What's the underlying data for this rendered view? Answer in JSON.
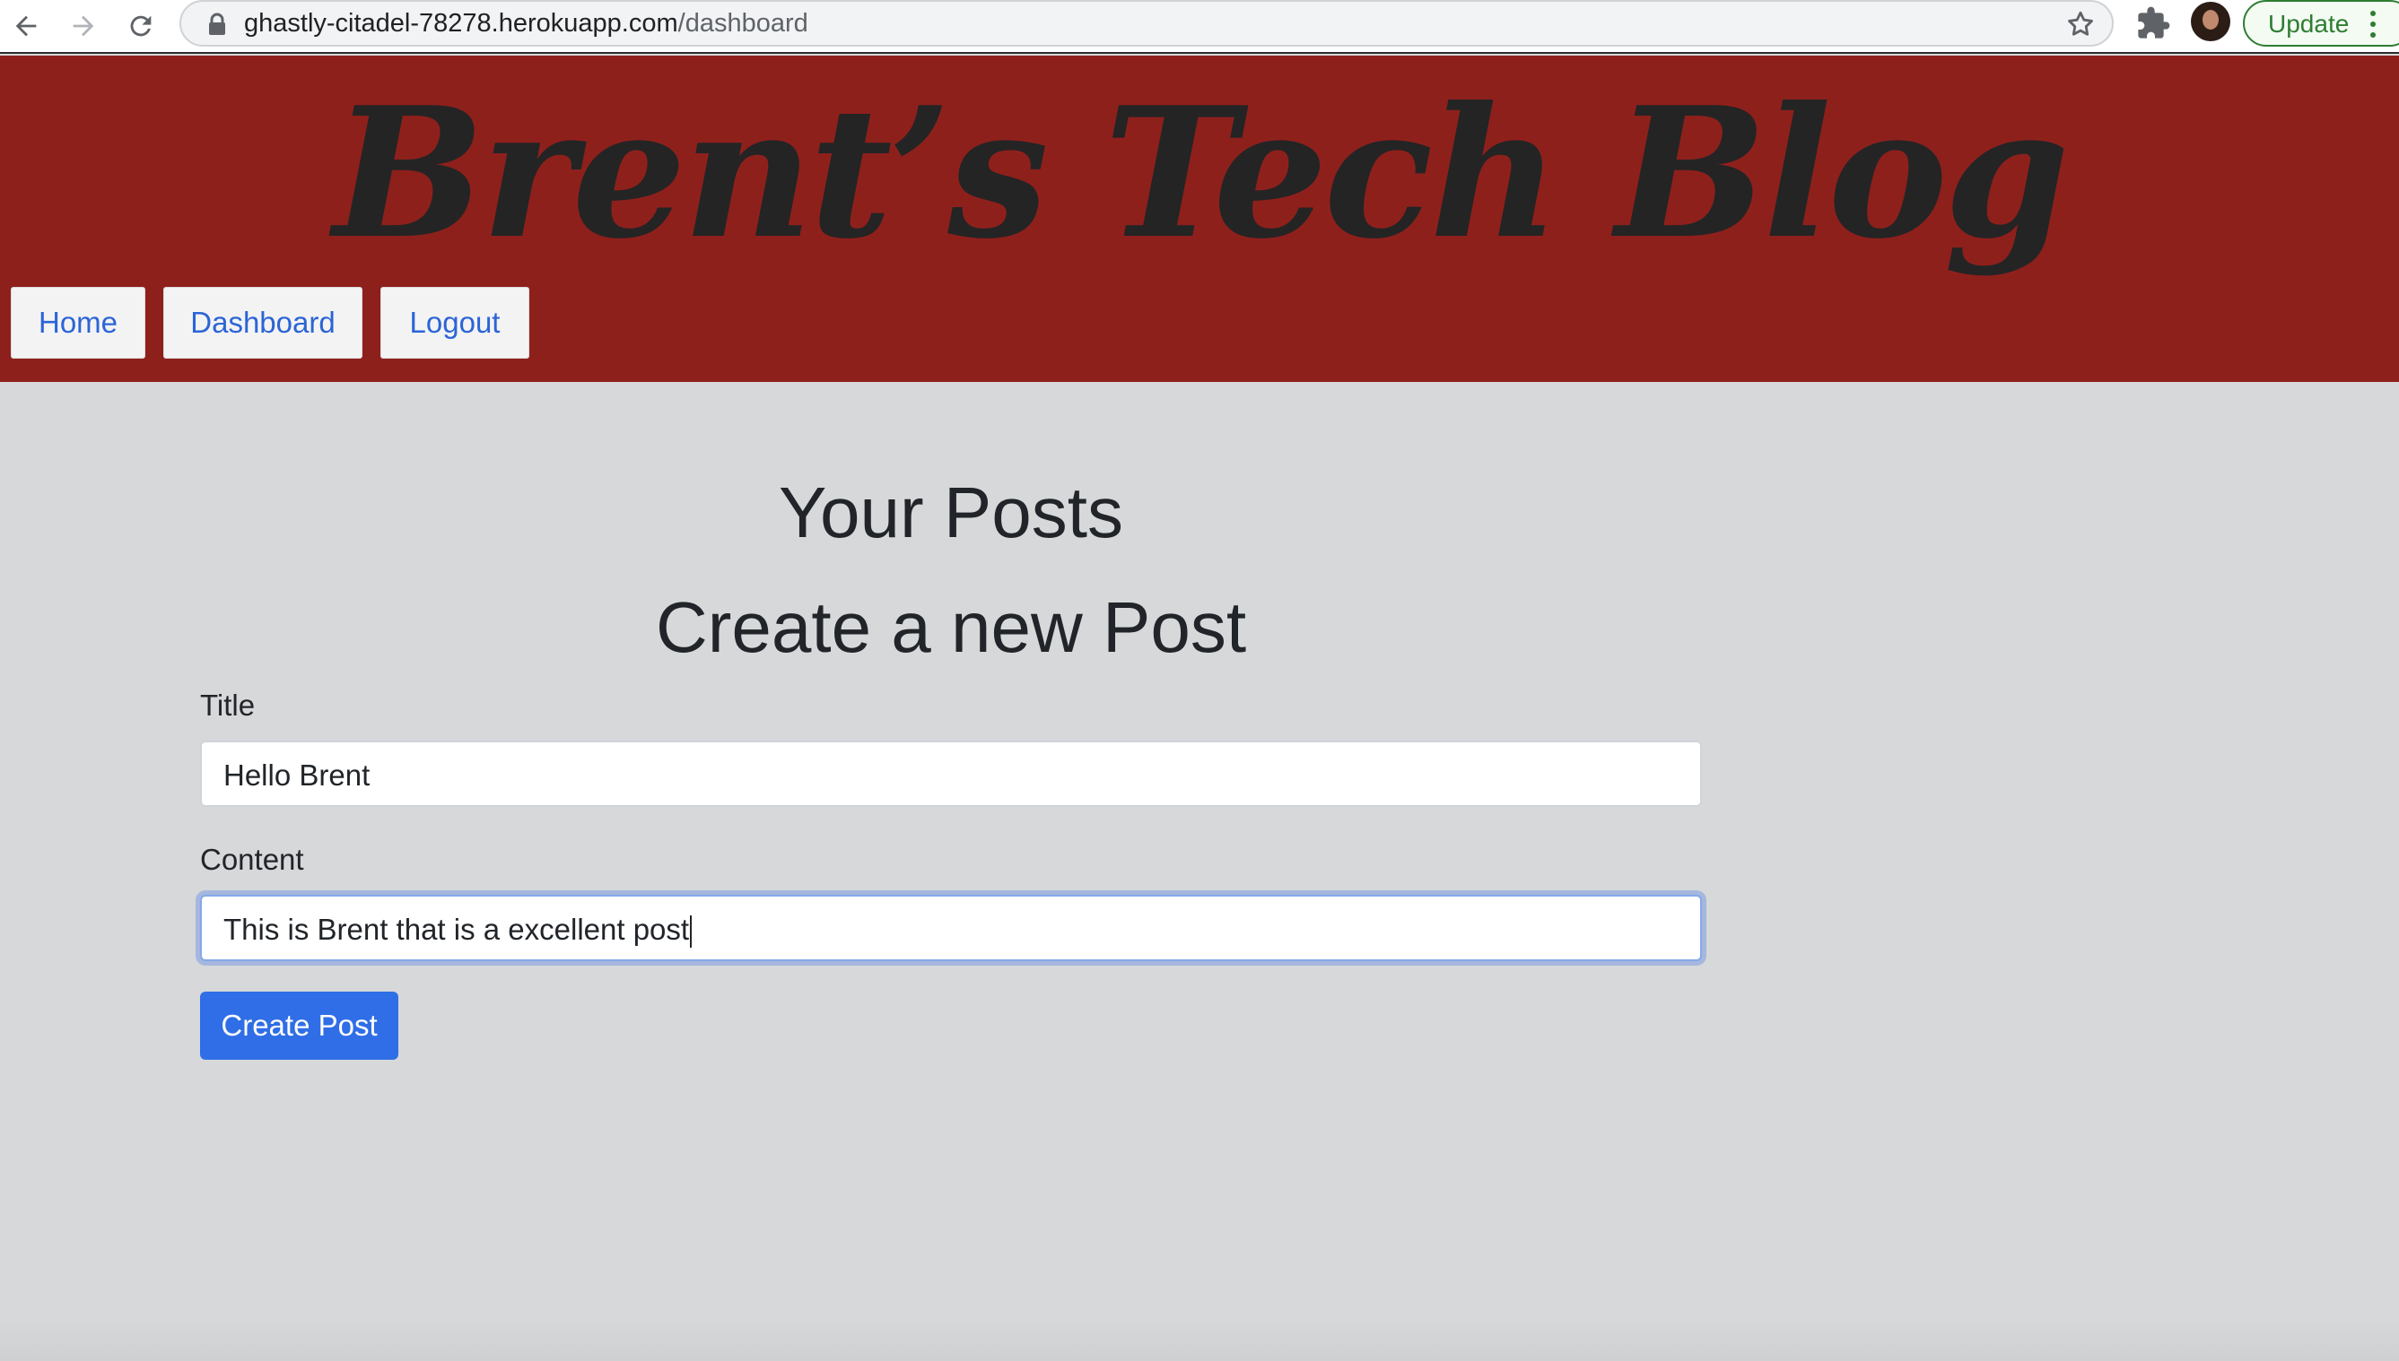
{
  "browser": {
    "url_domain": "ghastly-citadel-78278.herokuapp.com",
    "url_path": "/dashboard",
    "update_label": "Update",
    "icons": [
      "back-icon",
      "forward-icon",
      "reload-icon",
      "lock-icon",
      "star-icon",
      "extensions-icon",
      "profile-avatar",
      "kebab-menu-icon"
    ]
  },
  "header": {
    "title": "Brent’s Tech Blog",
    "nav": {
      "home": "Home",
      "dashboard": "Dashboard",
      "logout": "Logout"
    }
  },
  "main": {
    "your_posts_heading": "Your Posts",
    "create_heading": "Create a new Post",
    "title_label": "Title",
    "title_value": "Hello Brent",
    "content_label": "Content",
    "content_value": "This is Brent that is a excellent post",
    "submit_label": "Create Post"
  },
  "colors": {
    "header_bg": "#8e201c",
    "page_bg": "#d7d8da",
    "link_blue": "#2b64d6",
    "primary_button": "#2f6ee6",
    "update_green": "#2e7d32"
  }
}
